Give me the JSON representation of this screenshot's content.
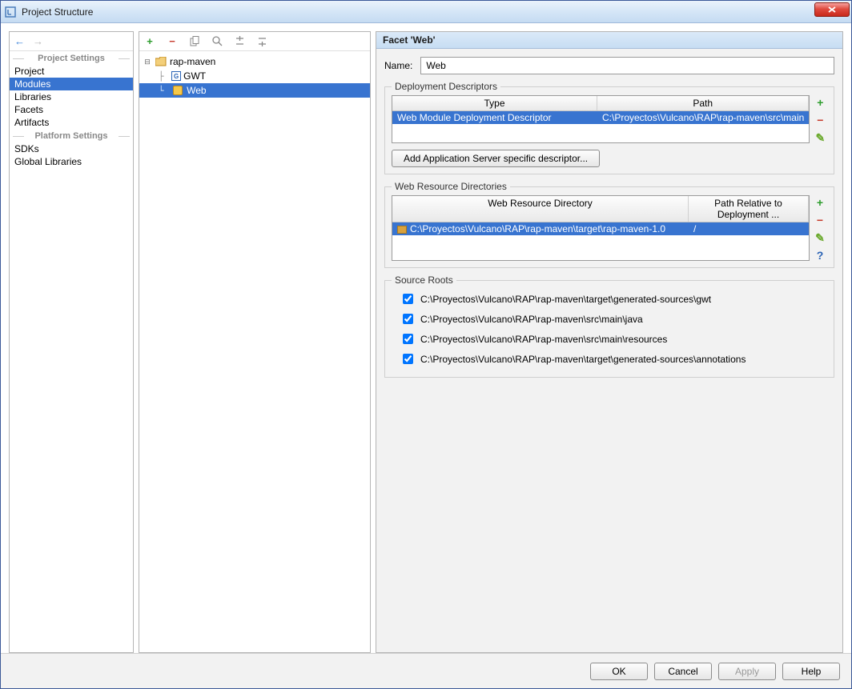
{
  "window": {
    "title": "Project Structure"
  },
  "sidebar": {
    "section1_title": "Project Settings",
    "section2_title": "Platform Settings",
    "items1": [
      "Project",
      "Modules",
      "Libraries",
      "Facets",
      "Artifacts"
    ],
    "items2": [
      "SDKs",
      "Global Libraries"
    ],
    "selected": "Modules"
  },
  "tree": {
    "root": {
      "label": "rap-maven"
    },
    "children": [
      {
        "label": "GWT"
      },
      {
        "label": "Web",
        "selected": true
      }
    ]
  },
  "detail": {
    "header": "Facet 'Web'",
    "name_label": "Name:",
    "name_value": "Web",
    "deployment": {
      "legend": "Deployment Descriptors",
      "col1": "Type",
      "col2": "Path",
      "row_type": "Web Module Deployment Descriptor",
      "row_path": "C:\\Proyectos\\Vulcano\\RAP\\rap-maven\\src\\main",
      "add_server_btn": "Add Application Server specific descriptor..."
    },
    "resources": {
      "legend": "Web Resource Directories",
      "col1": "Web Resource Directory",
      "col2": "Path Relative to Deployment ...",
      "row_dir": "C:\\Proyectos\\Vulcano\\RAP\\rap-maven\\target\\rap-maven-1.0",
      "row_rel": "/"
    },
    "source_roots": {
      "legend": "Source Roots",
      "paths": [
        "C:\\Proyectos\\Vulcano\\RAP\\rap-maven\\target\\generated-sources\\gwt",
        "C:\\Proyectos\\Vulcano\\RAP\\rap-maven\\src\\main\\java",
        "C:\\Proyectos\\Vulcano\\RAP\\rap-maven\\src\\main\\resources",
        "C:\\Proyectos\\Vulcano\\RAP\\rap-maven\\target\\generated-sources\\annotations"
      ]
    }
  },
  "buttons": {
    "ok": "OK",
    "cancel": "Cancel",
    "apply": "Apply",
    "help": "Help"
  }
}
